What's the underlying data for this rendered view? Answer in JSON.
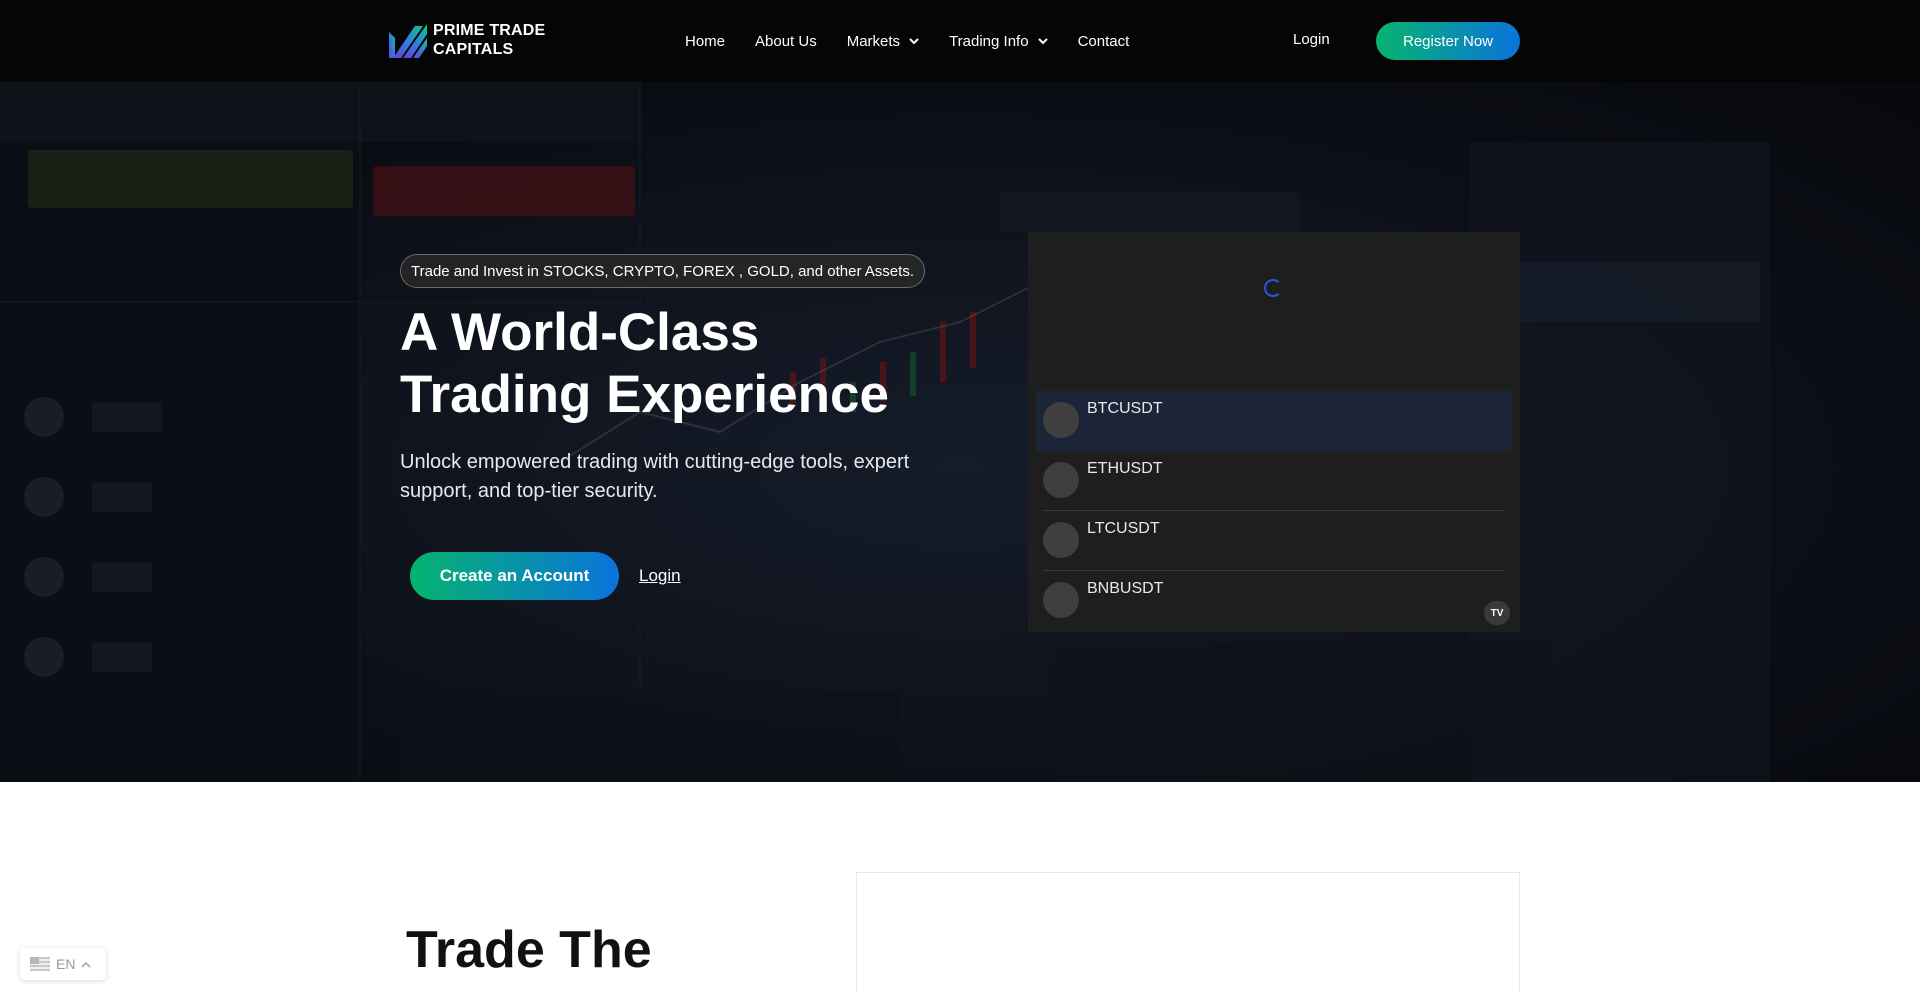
{
  "brand": {
    "line1": "PRIME TRADE",
    "line2": "CAPITALS"
  },
  "nav": {
    "items": [
      {
        "label": "Home",
        "dropdown": false
      },
      {
        "label": "About Us",
        "dropdown": false
      },
      {
        "label": "Markets",
        "dropdown": true
      },
      {
        "label": "Trading Info",
        "dropdown": true
      },
      {
        "label": "Contact",
        "dropdown": false
      }
    ],
    "login": "Login",
    "register": "Register Now"
  },
  "hero": {
    "badge": "Trade and Invest in STOCKS, CRYPTO, FOREX , GOLD, and other Assets.",
    "title_line1": "A World-Class",
    "title_line2": "Trading Experience",
    "subtitle": "Unlock empowered trading with cutting-edge tools, expert support, and top-tier security.",
    "cta": "Create an Account",
    "login": "Login"
  },
  "widget": {
    "tickers": [
      "BTCUSDT",
      "ETHUSDT",
      "LTCUSDT",
      "BNBUSDT"
    ],
    "active_index": 0,
    "logo": "TV"
  },
  "section2": {
    "title": "Trade The"
  },
  "language": {
    "code": "EN"
  },
  "colors": {
    "accent_start": "#06b46e",
    "accent_end": "#0a73dc",
    "nav_bg": "#050505",
    "widget_bg": "#1e1e1e",
    "active_row": "#1c2438"
  },
  "icons": {
    "logo": "prime-trade-logo-icon",
    "dropdown": "chevron-down-icon",
    "spinner": "loading-spinner-icon",
    "flag": "us-flag-icon",
    "lang_chevron": "chevron-up-icon"
  }
}
